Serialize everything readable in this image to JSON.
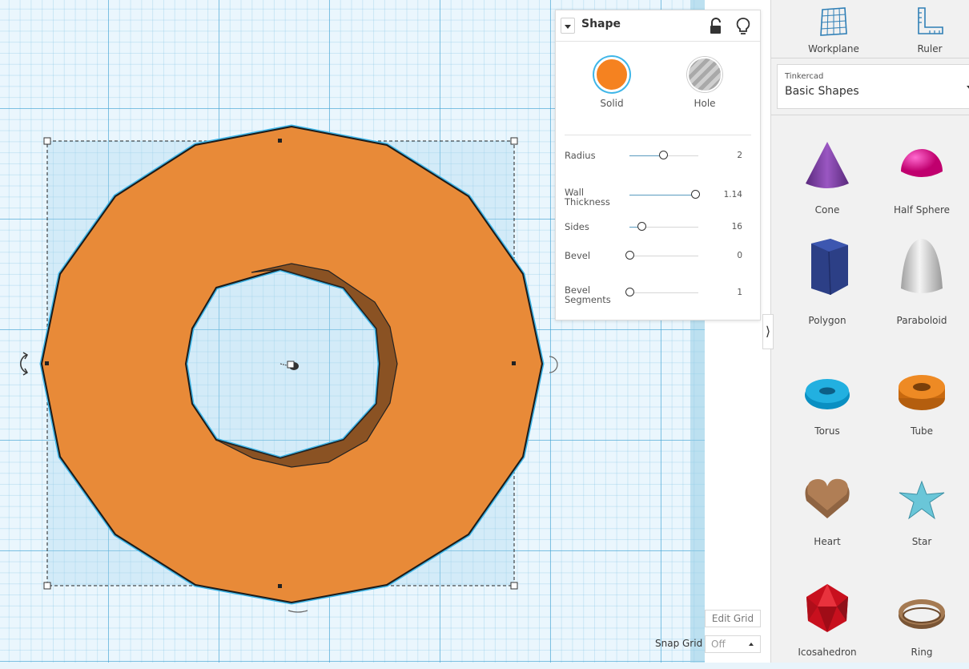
{
  "inspector": {
    "title": "Shape",
    "types": {
      "solid": "Solid",
      "hole": "Hole"
    },
    "params": [
      {
        "label": "Radius",
        "value": "2",
        "level": 0.49
      },
      {
        "label": "Wall\nThickness",
        "value": "1.14",
        "level": 0.95
      },
      {
        "label": "Sides",
        "value": "16",
        "level": 0.18
      },
      {
        "label": "Bevel",
        "value": "0",
        "level": 0.0
      },
      {
        "label": "Bevel\nSegments",
        "value": "1",
        "level": 0.0
      }
    ]
  },
  "tools": {
    "workplane": "Workplane",
    "ruler": "Ruler"
  },
  "library": {
    "caption": "Tinkercad",
    "name": "Basic Shapes"
  },
  "shapes": [
    {
      "label": "Cone",
      "icon": "cone-icon"
    },
    {
      "label": "Half Sphere",
      "icon": "half-sphere-icon"
    },
    {
      "label": "Polygon",
      "icon": "polygon-icon"
    },
    {
      "label": "Paraboloid",
      "icon": "paraboloid-icon"
    },
    {
      "label": "Torus",
      "icon": "torus-icon"
    },
    {
      "label": "Tube",
      "icon": "tube-icon"
    },
    {
      "label": "Heart",
      "icon": "heart-icon"
    },
    {
      "label": "Star",
      "icon": "star-icon"
    },
    {
      "label": "Icosahedron",
      "icon": "icosahedron-icon"
    },
    {
      "label": "Ring",
      "icon": "ring-icon"
    }
  ],
  "grid": {
    "edit_label": "Edit Grid",
    "snap_label": "Snap Grid",
    "snap_value": "Off"
  },
  "colors": {
    "shape_orange": "#e88a38",
    "shape_inner": "#8a5223",
    "selection_blue": "#3fb6e8",
    "solid_swatch": "#f58220"
  }
}
